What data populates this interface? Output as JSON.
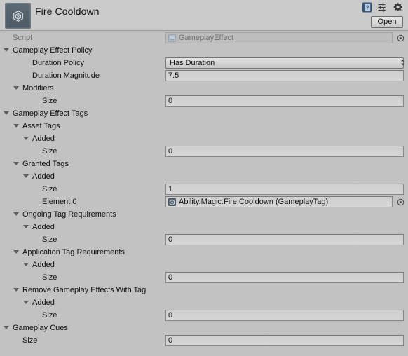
{
  "header": {
    "title": "Fire Cooldown",
    "asset_icon": "unity-scriptableobject-icon",
    "open_label": "Open",
    "icons": [
      {
        "name": "help-icon",
        "label": "Help"
      },
      {
        "name": "preset-icon",
        "label": "Preset"
      },
      {
        "name": "gear-icon",
        "label": "More Options"
      }
    ]
  },
  "accent": {
    "background": "#c2c2c2",
    "header_background": "#cbcbcb",
    "field_background": "#d2d2d2",
    "foldout_arrow": "#606060",
    "disabled_text": "#6b6b6b",
    "script_icon_blue": "#6e8fb8"
  },
  "rows": [
    {
      "name": "script",
      "indent": 0,
      "foldout": null,
      "label": "Script",
      "label_dim": true,
      "field": {
        "kind": "object",
        "value": "GameplayEffect",
        "icon": "cs-script-icon",
        "disabled": true,
        "picker": true
      }
    },
    {
      "name": "gameplay-effect-policy",
      "indent": 0,
      "foldout": "expanded",
      "label": "Gameplay Effect Policy",
      "field": null
    },
    {
      "name": "duration-policy",
      "indent": 2,
      "foldout": null,
      "label": "Duration Policy",
      "field": {
        "kind": "popup",
        "value": "Has Duration"
      }
    },
    {
      "name": "duration-magnitude",
      "indent": 2,
      "foldout": null,
      "label": "Duration Magnitude",
      "field": {
        "kind": "text",
        "value": "7.5"
      }
    },
    {
      "name": "modifiers",
      "indent": 1,
      "foldout": "expanded",
      "label": "Modifiers",
      "field": null
    },
    {
      "name": "modifiers-size",
      "indent": 3,
      "foldout": null,
      "label": "Size",
      "field": {
        "kind": "text",
        "value": "0"
      }
    },
    {
      "name": "gameplay-effect-tags",
      "indent": 0,
      "foldout": "expanded",
      "label": "Gameplay Effect Tags",
      "field": null
    },
    {
      "name": "asset-tags",
      "indent": 1,
      "foldout": "expanded",
      "label": "Asset Tags",
      "field": null
    },
    {
      "name": "asset-tags-added",
      "indent": 2,
      "foldout": "expanded",
      "label": "Added",
      "field": null
    },
    {
      "name": "asset-tags-size",
      "indent": 3,
      "foldout": null,
      "label": "Size",
      "field": {
        "kind": "text",
        "value": "0"
      }
    },
    {
      "name": "granted-tags",
      "indent": 1,
      "foldout": "expanded",
      "label": "Granted Tags",
      "field": null
    },
    {
      "name": "granted-tags-added",
      "indent": 2,
      "foldout": "expanded",
      "label": "Added",
      "field": null
    },
    {
      "name": "granted-tags-size",
      "indent": 3,
      "foldout": null,
      "label": "Size",
      "field": {
        "kind": "text",
        "value": "1"
      }
    },
    {
      "name": "granted-tags-element-0",
      "indent": 3,
      "foldout": null,
      "label": "Element 0",
      "field": {
        "kind": "object",
        "value": "Ability.Magic.Fire.Cooldown (GameplayTag)",
        "icon": "gameplaytag-asset-icon",
        "disabled": false,
        "picker": true
      }
    },
    {
      "name": "ongoing-tag-requirements",
      "indent": 1,
      "foldout": "expanded",
      "label": "Ongoing Tag Requirements",
      "field": null
    },
    {
      "name": "ongoing-tag-requirements-added",
      "indent": 2,
      "foldout": "expanded",
      "label": "Added",
      "field": null
    },
    {
      "name": "ongoing-tag-requirements-size",
      "indent": 3,
      "foldout": null,
      "label": "Size",
      "field": {
        "kind": "text",
        "value": "0"
      }
    },
    {
      "name": "application-tag-requirements",
      "indent": 1,
      "foldout": "expanded",
      "label": "Application Tag Requirements",
      "field": null
    },
    {
      "name": "application-tag-requirements-added",
      "indent": 2,
      "foldout": "expanded",
      "label": "Added",
      "field": null
    },
    {
      "name": "application-tag-requirements-size",
      "indent": 3,
      "foldout": null,
      "label": "Size",
      "field": {
        "kind": "text",
        "value": "0"
      }
    },
    {
      "name": "remove-gameplay-effects-with-tag",
      "indent": 1,
      "foldout": "expanded",
      "label": "Remove Gameplay Effects With Tag",
      "field": null
    },
    {
      "name": "remove-gameplay-effects-with-tag-added",
      "indent": 2,
      "foldout": "expanded",
      "label": "Added",
      "field": null
    },
    {
      "name": "remove-gameplay-effects-with-tag-size",
      "indent": 3,
      "foldout": null,
      "label": "Size",
      "field": {
        "kind": "text",
        "value": "0"
      }
    },
    {
      "name": "gameplay-cues",
      "indent": 0,
      "foldout": "expanded",
      "label": "Gameplay Cues",
      "field": null
    },
    {
      "name": "gameplay-cues-size",
      "indent": 1,
      "foldout": null,
      "label": "Size",
      "field": {
        "kind": "text",
        "value": "0"
      }
    }
  ]
}
